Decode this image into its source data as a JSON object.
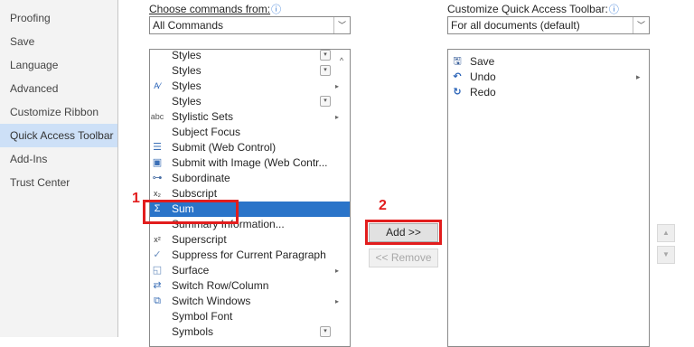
{
  "nav": {
    "items": [
      {
        "label": "Proofing"
      },
      {
        "label": "Save"
      },
      {
        "label": "Language"
      },
      {
        "label": "Advanced"
      },
      {
        "label": "Customize Ribbon"
      },
      {
        "label": "Quick Access Toolbar",
        "selected": true
      },
      {
        "label": "Add-Ins"
      },
      {
        "label": "Trust Center"
      }
    ]
  },
  "left_panel": {
    "choose_label": "Choose commands from:",
    "choose_value": "All Commands",
    "commands": [
      {
        "label": "Styles",
        "icon": "none",
        "control": "dropdown-box"
      },
      {
        "label": "Styles",
        "icon": "none",
        "control": "dropdown-box"
      },
      {
        "label": "Styles",
        "icon": "styles-icon",
        "control": "submenu-arrow"
      },
      {
        "label": "Styles",
        "icon": "none",
        "control": "dropdown-box"
      },
      {
        "label": "Stylistic Sets",
        "icon": "stylistic-sets-icon",
        "control": "submenu-arrow"
      },
      {
        "label": "Subject Focus",
        "icon": "none"
      },
      {
        "label": "Submit (Web Control)",
        "icon": "web-form-icon"
      },
      {
        "label": "Submit with Image (Web Contr...",
        "icon": "image-form-icon"
      },
      {
        "label": "Subordinate",
        "icon": "subordinate-icon"
      },
      {
        "label": "Subscript",
        "icon": "subscript-icon"
      },
      {
        "label": "Sum",
        "icon": "sum-icon",
        "selected": true
      },
      {
        "label": "Summary Information...",
        "icon": "none"
      },
      {
        "label": "Superscript",
        "icon": "superscript-icon"
      },
      {
        "label": "Suppress for Current Paragraph",
        "icon": "checkmark-icon"
      },
      {
        "label": "Surface",
        "icon": "surface-icon",
        "control": "submenu-arrow"
      },
      {
        "label": "Switch Row/Column",
        "icon": "switch-row-column-icon"
      },
      {
        "label": "Switch Windows",
        "icon": "switch-windows-icon",
        "control": "submenu-arrow"
      },
      {
        "label": "Symbol Font",
        "icon": "none"
      },
      {
        "label": "Symbols",
        "icon": "none",
        "control": "dropdown-box"
      }
    ]
  },
  "right_panel": {
    "customize_label": "Customize Quick Access Toolbar:",
    "customize_value": "For all documents (default)",
    "items": [
      {
        "label": "Save",
        "icon": "save-icon"
      },
      {
        "label": "Undo",
        "icon": "undo-icon",
        "control": "submenu-arrow"
      },
      {
        "label": "Redo",
        "icon": "redo-icon"
      }
    ]
  },
  "buttons": {
    "add_label": "Add >>",
    "remove_label": "<< Remove"
  },
  "callouts": {
    "one": "1",
    "two": "2"
  },
  "colors": {
    "selection": "#2a74c9",
    "nav_selected": "#cde0f7",
    "callout": "#e21d1d",
    "info_icon": "#3b7dd8"
  }
}
